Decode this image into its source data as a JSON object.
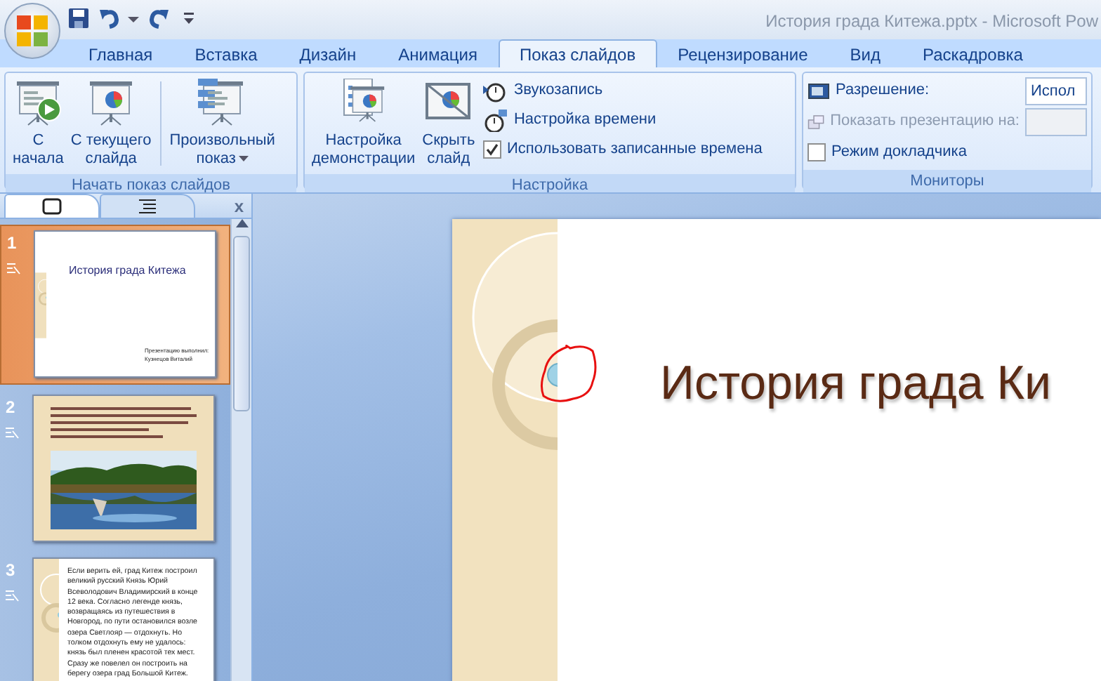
{
  "window": {
    "title": "История града Китежа.pptx - Microsoft Pow"
  },
  "tabs": [
    {
      "label": "Главная",
      "selected": false
    },
    {
      "label": "Вставка",
      "selected": false
    },
    {
      "label": "Дизайн",
      "selected": false
    },
    {
      "label": "Анимация",
      "selected": false
    },
    {
      "label": "Показ слайдов",
      "selected": true
    },
    {
      "label": "Рецензирование",
      "selected": false
    },
    {
      "label": "Вид",
      "selected": false
    },
    {
      "label": "Раскадровка",
      "selected": false
    }
  ],
  "ribbon": {
    "start_group": {
      "label": "Начать показ слайдов",
      "buttons": [
        {
          "kind": "play",
          "lines": [
            "С",
            "начала"
          ],
          "dropdown": false
        },
        {
          "kind": "current",
          "lines": [
            "С текущего",
            "слайда"
          ],
          "dropdown": false
        },
        {
          "kind": "custom",
          "lines": [
            "Произвольный",
            "показ"
          ],
          "dropdown": true
        }
      ]
    },
    "setup_group": {
      "label": "Настройка",
      "buttons": [
        {
          "kind": "setup",
          "lines": [
            "Настройка",
            "демонстрации"
          ]
        },
        {
          "kind": "hide",
          "lines": [
            "Скрыть",
            "слайд"
          ]
        }
      ],
      "small_items": [
        {
          "kind": "record",
          "label": "Звукозапись"
        },
        {
          "kind": "timing",
          "label": "Настройка времени"
        },
        {
          "kind": "checkbox",
          "label": "Использовать записанные времена",
          "checked": true
        }
      ]
    },
    "monitors_group": {
      "label": "Мониторы",
      "items": [
        {
          "kind": "resolution",
          "label": "Разрешение:",
          "value": "Испол",
          "disabled": false
        },
        {
          "kind": "show_on",
          "label": "Показать презентацию на:",
          "disabled": true
        },
        {
          "kind": "checkbox",
          "label": "Режим докладчика",
          "checked": false
        }
      ]
    }
  },
  "pane": {
    "tabs": [
      {
        "kind": "slides",
        "selected": true
      },
      {
        "kind": "outline",
        "selected": false
      }
    ],
    "close": "x",
    "slides": [
      {
        "number": "1",
        "selected": true,
        "kind": "title",
        "title": "История града Китежа",
        "subtitle": "Презентацию выполнил: Кузнецов Виталий"
      },
      {
        "number": "2",
        "selected": false,
        "kind": "picture"
      },
      {
        "number": "3",
        "selected": false,
        "kind": "text",
        "text": "Если верить ей, град Китеж построил великий русский Князь Юрий Всеволодович Владимирский в конце 12 века. Согласно легенде князь, возвращаясь из путешествия в Новгород, по пути остановился возле озера Светлояр — отдохнуть. Но толком отдохнуть ему не удалось: князь был пленен красотой тех мест. Сразу же повелел он построить на берегу озера град Большой Китеж."
      }
    ]
  },
  "slide": {
    "title": "История града Ки"
  }
}
